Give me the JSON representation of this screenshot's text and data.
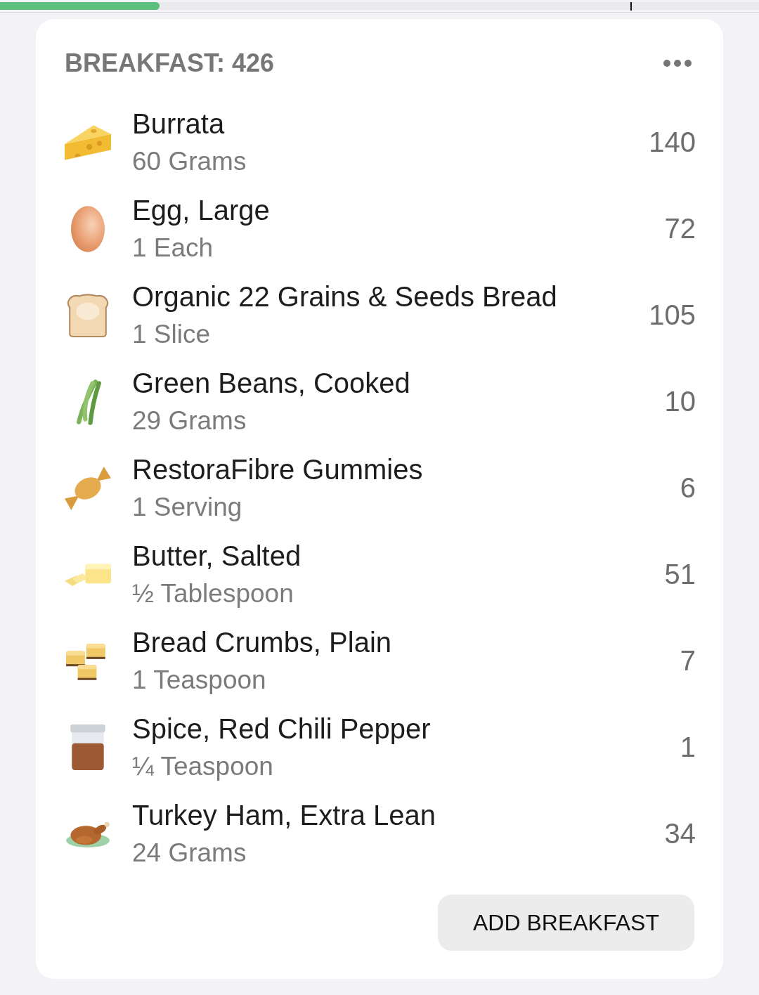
{
  "progress": {
    "level": 0.21
  },
  "meal": {
    "title": "BREAKFAST: 426",
    "items": [
      {
        "kind": "cheese",
        "name": "Burrata",
        "amount": "60 Grams",
        "calories": "140"
      },
      {
        "kind": "egg",
        "name": "Egg, Large",
        "amount": "1 Each",
        "calories": "72"
      },
      {
        "kind": "bread",
        "name": "Organic 22 Grains & Seeds Bread",
        "amount": "1 Slice",
        "calories": "105"
      },
      {
        "kind": "beans",
        "name": "Green Beans, Cooked",
        "amount": "29 Grams",
        "calories": "10"
      },
      {
        "kind": "candy",
        "name": "RestoraFibre Gummies",
        "amount": "1 Serving",
        "calories": "6"
      },
      {
        "kind": "butter",
        "name": "Butter, Salted",
        "amount": "½ Tablespoon",
        "calories": "51"
      },
      {
        "kind": "cubes",
        "name": "Bread Crumbs, Plain",
        "amount": "1 Teaspoon",
        "calories": "7"
      },
      {
        "kind": "spice",
        "name": "Spice, Red Chili Pepper",
        "amount": "¼ Teaspoon",
        "calories": "1"
      },
      {
        "kind": "poultry",
        "name": "Turkey Ham, Extra Lean",
        "amount": "24 Grams",
        "calories": "34"
      }
    ],
    "add_button": "ADD BREAKFAST"
  }
}
